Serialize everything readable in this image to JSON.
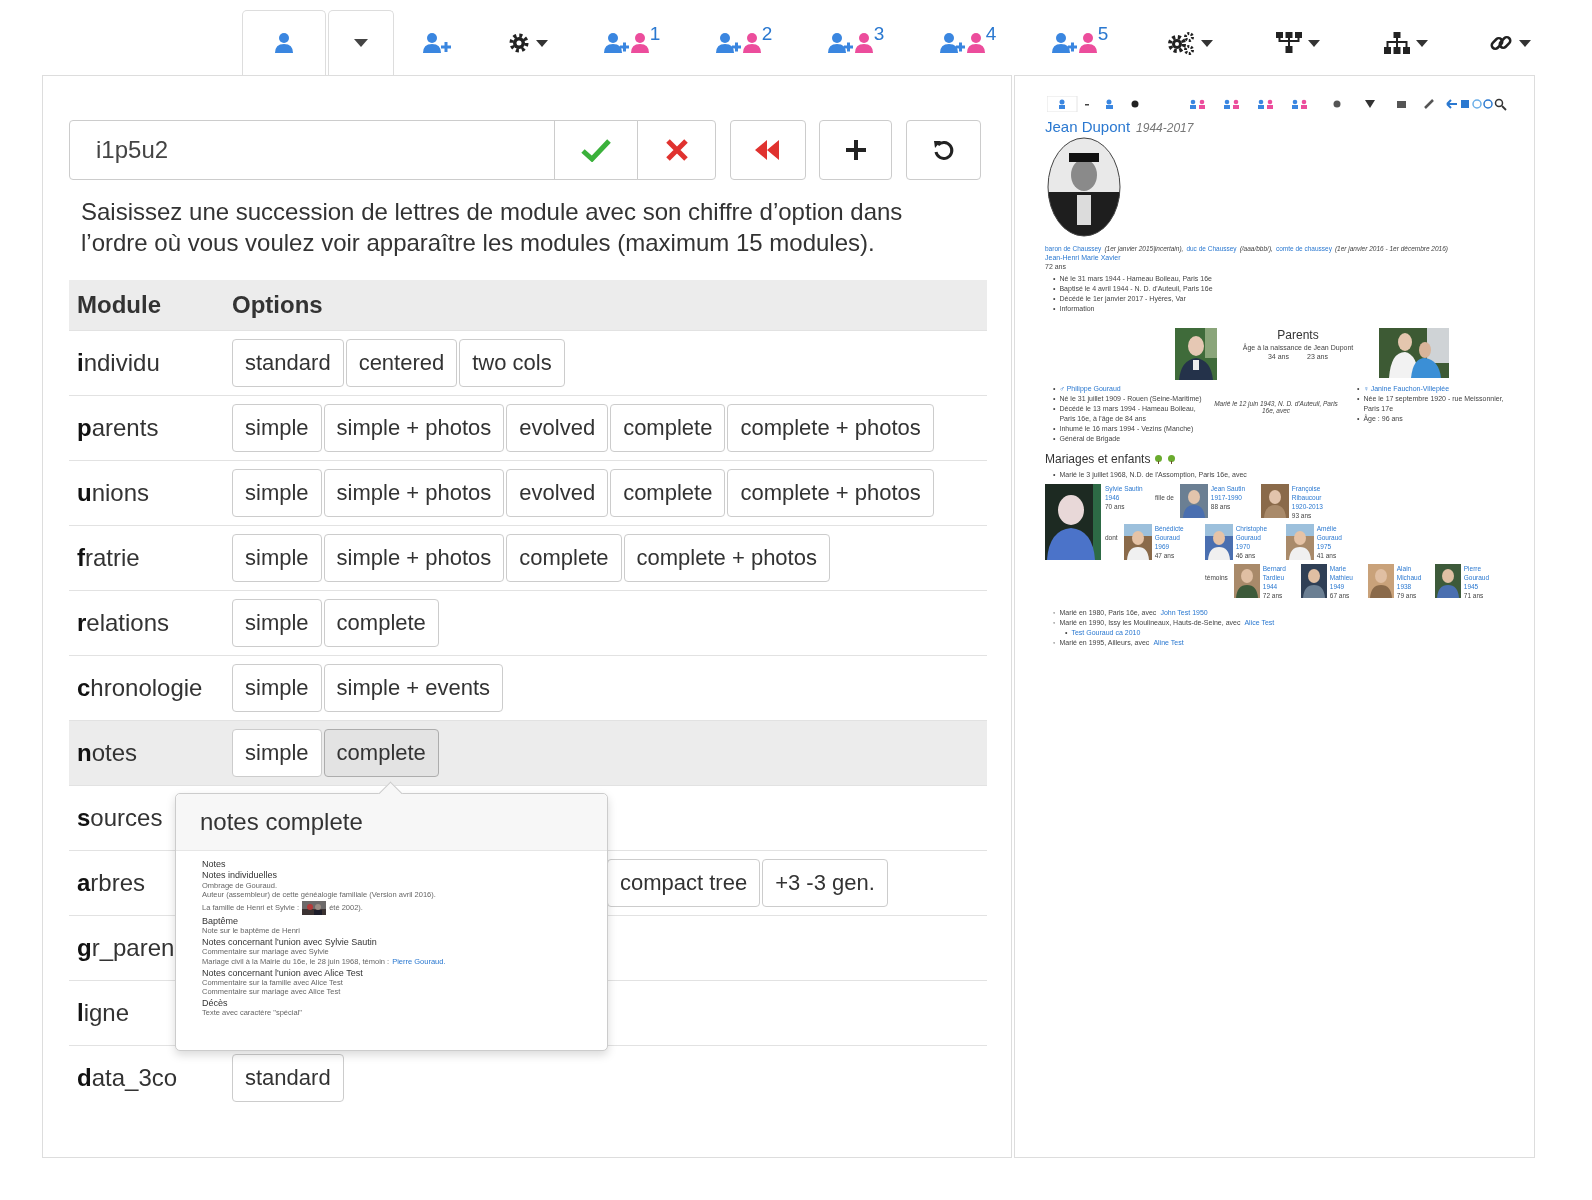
{
  "toolbar": {
    "tabs": [
      {
        "kind": "person",
        "selected": true
      },
      {
        "kind": "dropdown",
        "selected": false
      },
      {
        "kind": "add",
        "selected": false
      },
      {
        "kind": "gear",
        "selected": false
      },
      {
        "kind": "couple",
        "label": "1",
        "selected": false
      },
      {
        "kind": "couple",
        "label": "2",
        "selected": false
      },
      {
        "kind": "couple",
        "label": "3",
        "selected": false
      },
      {
        "kind": "couple",
        "label": "4",
        "selected": false
      },
      {
        "kind": "couple",
        "label": "5",
        "selected": false
      },
      {
        "kind": "gears",
        "selected": false
      },
      {
        "kind": "tree",
        "selected": false
      },
      {
        "kind": "sitemap",
        "selected": false
      },
      {
        "kind": "link",
        "selected": false
      }
    ]
  },
  "editor": {
    "value": "i1p5u2",
    "buttons": [
      {
        "kind": "ok"
      },
      {
        "kind": "cancel"
      },
      {
        "kind": "rewind"
      },
      {
        "kind": "add"
      },
      {
        "kind": "undo"
      }
    ],
    "help": "Saisissez une succession de lettres de module avec son chiffre d’option dans l’ordre où vous voulez voir apparaître les modules (maximum 15 modules)."
  },
  "table": {
    "columns": [
      "Module",
      "Options"
    ],
    "rows": [
      {
        "module": "**i**ndividu",
        "selected": false,
        "options": [
          {
            "label": "standard",
            "selected": false
          },
          {
            "label": "centered",
            "selected": false
          },
          {
            "label": "two cols",
            "selected": false
          }
        ]
      },
      {
        "module": "**p**arents",
        "selected": false,
        "options": [
          {
            "label": "simple",
            "selected": false
          },
          {
            "label": "simple + photos",
            "selected": false
          },
          {
            "label": "evolved",
            "selected": false
          },
          {
            "label": "complete",
            "selected": false
          },
          {
            "label": "complete + photos",
            "selected": false
          }
        ]
      },
      {
        "module": "**u**nions",
        "selected": false,
        "options": [
          {
            "label": "simple",
            "selected": false
          },
          {
            "label": "simple + photos",
            "selected": false
          },
          {
            "label": "evolved",
            "selected": false
          },
          {
            "label": "complete",
            "selected": false
          },
          {
            "label": "complete + photos",
            "selected": false
          }
        ]
      },
      {
        "module": "**f**ratrie",
        "selected": false,
        "options": [
          {
            "label": "simple",
            "selected": false
          },
          {
            "label": "simple + photos",
            "selected": false
          },
          {
            "label": "complete",
            "selected": false
          },
          {
            "label": "complete + photos",
            "selected": false
          }
        ]
      },
      {
        "module": "**r**elations",
        "selected": false,
        "options": [
          {
            "label": "simple",
            "selected": false
          },
          {
            "label": "complete",
            "selected": false
          }
        ]
      },
      {
        "module": "**c**hronologie",
        "selected": false,
        "options": [
          {
            "label": "simple",
            "selected": false
          },
          {
            "label": "simple + events",
            "selected": false
          }
        ]
      },
      {
        "module": "**n**otes",
        "selected": true,
        "options": [
          {
            "label": "simple",
            "selected": false
          },
          {
            "label": "complete",
            "selected": true
          }
        ]
      },
      {
        "module": "**s**ources",
        "selected": false,
        "options": []
      },
      {
        "module": "**a**rbres",
        "selected": false,
        "covered": true,
        "options": [
          {
            "label": "compact tree",
            "selected": false
          },
          {
            "label": "+3 -3 gen.",
            "selected": false
          }
        ]
      },
      {
        "module": "**g**r_paren",
        "selected": false,
        "options": []
      },
      {
        "module": "**l**igne",
        "selected": false,
        "options": []
      },
      {
        "module": "**d**ata_3co",
        "selected": false,
        "options": [
          {
            "label": "standard",
            "selected": false
          }
        ]
      }
    ]
  },
  "popover": {
    "title": "notes complete",
    "lines": [
      {
        "kind": "h1",
        "text": "Notes"
      },
      {
        "kind": "h2",
        "text": "Notes individuelles"
      },
      {
        "kind": "p",
        "text": "Ombrage de Gouraud."
      },
      {
        "kind": "p",
        "text": "Auteur (assembleur) de cette généalogie familiale (Version avril 2016)."
      },
      {
        "text": "La famille de Henri et Sylvie :",
        "after": "été 2002)."
      },
      {
        "kind": "h2",
        "text": "Baptême"
      },
      {
        "kind": "p",
        "text": "Note sur le baptême de Henri"
      },
      {
        "kind": "h2",
        "text": "Notes concernant l'union avec Sylvie Sautin"
      },
      {
        "kind": "p",
        "text": "Commentaire sur mariage avec Sylvie"
      },
      {
        "kind": "link",
        "text": "Mariage civil à la Mairie du 16e, le 28 juin 1968, témoin :",
        "link": "Pierre Gouraud."
      },
      {
        "kind": "h2",
        "text": "Notes concernant l'union avec Alice Test"
      },
      {
        "kind": "p",
        "text": "Commentaire sur la famille avec Alice Test"
      },
      {
        "kind": "p",
        "text": "Commentaire sur mariage avec Alice Test"
      },
      {
        "kind": "h2",
        "text": "Décès"
      },
      {
        "kind": "p",
        "text": "Texte avec caractère \"spécial\""
      }
    ]
  },
  "preview": {
    "name": "Jean Dupont",
    "dates": "1944-2017",
    "titles": [
      {
        "link": "baron de Chaussey",
        "period": "(1er janvier 2015|incertain),"
      },
      {
        "link": "duc de Chaussey",
        "period": "(/aaa/bbb/),"
      },
      {
        "link": "comte de chaussey",
        "period": "(1er janvier 2016 - 1er décembre 2016)"
      }
    ],
    "firstnames": "Jean-Henri Marie Xavier",
    "age": "72 ans",
    "facts": [
      {
        "marker": "•",
        "text": "Né le 31 mars 1944 - Hameau Boileau, Paris 16e"
      },
      {
        "marker": "•",
        "text": "Baptisé le 4 avril 1944 - N. D. d'Auteuil, Paris 16e"
      },
      {
        "marker": "•",
        "text": "Décédé le 1er janvier 2017 - Hyères, Var"
      },
      {
        "marker": "•",
        "text": "Information"
      }
    ],
    "parents": {
      "title": "Parents",
      "age_caption": "Âge à la naissance de Jean Dupont",
      "father_age": "34 ans",
      "mother_age": "23 ans",
      "father": {
        "marker": "•",
        "text": "♂ Philippe Gouraud"
      },
      "father_facts": [
        {
          "marker": "•",
          "text": "Né le 31 juillet 1909 - Rouen (Seine-Maritime)"
        },
        {
          "marker": "•",
          "text": "Décédé le 13 mars 1994 - Hameau Boileau, Paris 16e, à l'âge de 84 ans"
        },
        {
          "marker": "•",
          "text": "Inhumé le 16 mars 1994 - Vezins (Manche)"
        },
        {
          "marker": "•",
          "text": "Général de Brigade"
        }
      ],
      "marriage": "Marié le 12 juin 1943, N. D. d'Auteuil, Paris 16e, avec",
      "mother": {
        "marker": "•",
        "text": "♀ Janine Fauchon-Villeplée"
      },
      "mother_facts": [
        {
          "marker": "•",
          "text": "Née le 17 septembre 1920 - rue Meissonnier, Paris 17e"
        },
        {
          "marker": "•",
          "text": "Âge : 96 ans"
        }
      ]
    },
    "unions_title": "Mariages et enfants",
    "marriage": {
      "marker": "•",
      "text": "Marié le 3 juillet 1968, N.D. de l'Assomption, Paris 16e, avec"
    },
    "spouse": {
      "name": "Sylvie Sautin",
      "dates": "1946",
      "age": "70 ans"
    },
    "daughter_of": "fille de",
    "in_laws": [
      {
        "name": "Jean Sautin",
        "dates": "1917-1990",
        "age": "88 ans"
      },
      {
        "name": "Françoise Ribaucour",
        "dates": "1920-2013",
        "age": "93 ans"
      }
    ],
    "children_label": "dont",
    "children": [
      {
        "name": "Bénédicte Gouraud",
        "dates": "1969",
        "age": "47 ans"
      },
      {
        "name": "Christophe Gouraud",
        "dates": "1970",
        "age": "46 ans"
      },
      {
        "name": "Amélie Gouraud",
        "dates": "1975",
        "age": "41 ans"
      }
    ],
    "witnesses_label": "témoins",
    "witnesses": [
      {
        "name": "Bernard Tardieu",
        "dates": "1944",
        "age": "72 ans"
      },
      {
        "name": "Marie Mathieu",
        "dates": "1949",
        "age": "67 ans"
      },
      {
        "name": "Alain Michaud",
        "dates": "1938",
        "age": "79 ans"
      },
      {
        "name": "Pierre Gouraud",
        "dates": "1945",
        "age": "71 ans"
      }
    ],
    "other_unions": [
      {
        "marker": "◦",
        "text": "Marié en 1980, Paris 16e, avec",
        "link": "John Test 1950"
      },
      {
        "marker": "◦",
        "text": "Marié en 1990, Issy les Moulineaux, Hauts-de-Seine, avec",
        "link": "Alice Test",
        "child": {
          "marker": "•",
          "text": "Test Gouraud ca 2010"
        }
      },
      {
        "marker": "◦",
        "text": "Marié en 1995, Ailleurs, avec",
        "link": "Aline Test"
      }
    ]
  }
}
